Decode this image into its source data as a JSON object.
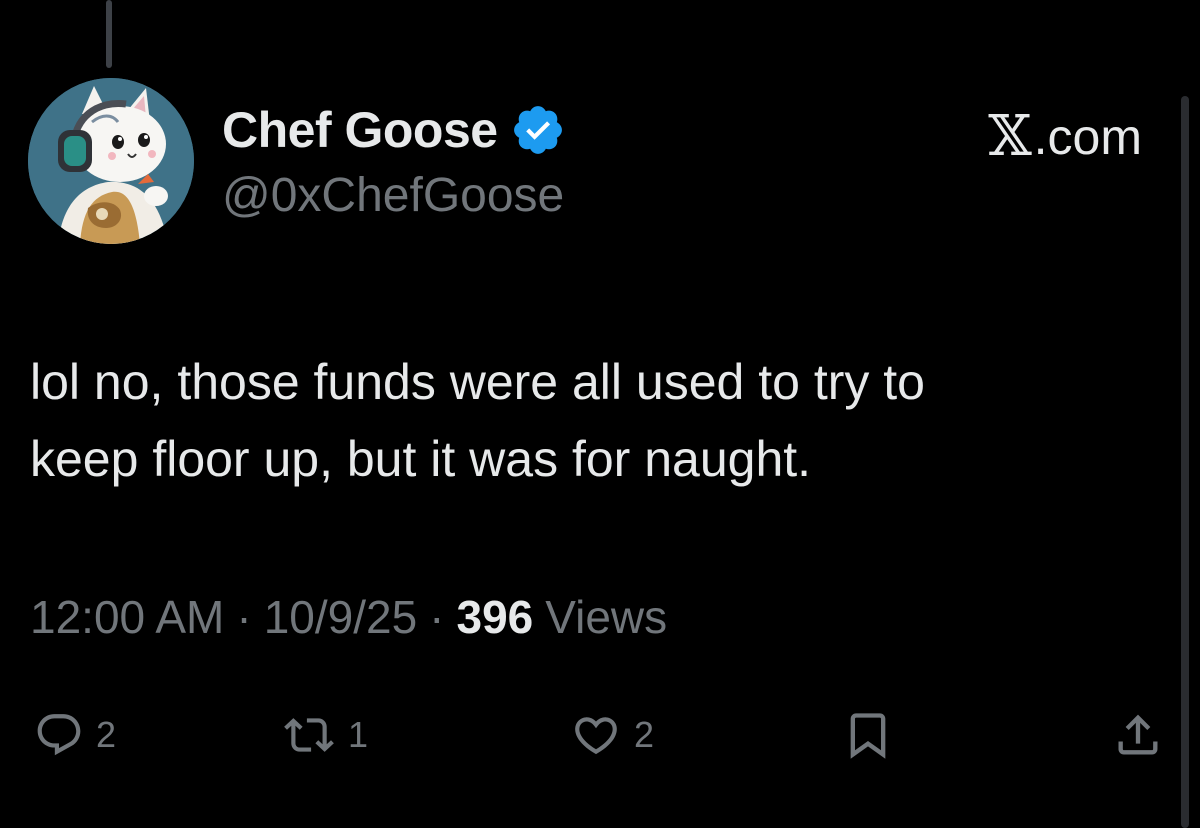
{
  "author": {
    "display_name": "Chef Goose",
    "handle": "@0xChefGoose",
    "verified": true,
    "avatar_icon": "cartoon-cat-avatar-icon"
  },
  "brand": {
    "x_glyph": "𝕏",
    "domain": ".com"
  },
  "tweet": {
    "line1": "lol no, those funds were all used to try to",
    "line2": "keep floor up, but it was for naught."
  },
  "meta": {
    "time": "12:00 AM",
    "separator": "·",
    "date": "10/9/25",
    "views_count": "396",
    "views_label": "Views"
  },
  "actions": {
    "replies": "2",
    "reposts": "1",
    "likes": "2"
  },
  "colors": {
    "background": "#000000",
    "primary_text": "#e7e9ea",
    "secondary_text": "#71767b",
    "verified_blue": "#1d9bf0"
  },
  "icons": {
    "reply": "reply-icon",
    "repost": "repost-icon",
    "like": "heart-icon",
    "bookmark": "bookmark-icon",
    "share": "share-icon"
  }
}
